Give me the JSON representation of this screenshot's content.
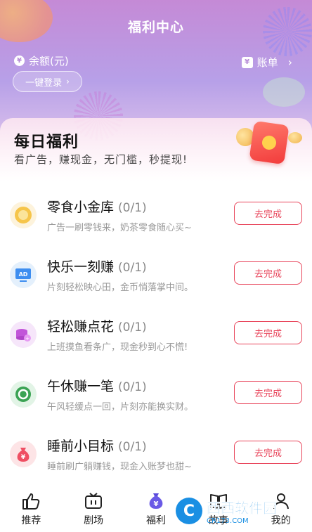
{
  "header": {
    "title": "福利中心",
    "balance_label": "余额(元)",
    "login_label": "一键登录",
    "bill_label": "账单",
    "yen_symbol": "¥"
  },
  "daily": {
    "title": "每日福利",
    "subtitle": "看广告，赚现金，无门槛，秒提现!"
  },
  "tasks": [
    {
      "name": "零食小金库",
      "progress": "(0/1)",
      "desc": "广告一刷零钱来，奶茶零食随心买~",
      "button": "去完成",
      "icon": "coin-icon"
    },
    {
      "name": "快乐一刻赚",
      "progress": "(0/1)",
      "desc": "片刻轻松映心田，金币悄落掌中间。",
      "button": "去完成",
      "icon": "ad-screen-icon"
    },
    {
      "name": "轻松赚点花",
      "progress": "(0/1)",
      "desc": "上班摸鱼看条广，现金秒到心不慌!",
      "button": "去完成",
      "icon": "coin-stack-icon"
    },
    {
      "name": "午休赚一笔",
      "progress": "(0/1)",
      "desc": "午风轻缓点一回，片刻亦能换实财。",
      "button": "去完成",
      "icon": "refresh-coin-icon"
    },
    {
      "name": "睡前小目标",
      "progress": "(0/1)",
      "desc": "睡前刷广躺赚钱，现金入账梦也甜~",
      "button": "去完成",
      "icon": "money-bag-icon"
    }
  ],
  "tabbar": [
    {
      "label": "推荐",
      "icon": "thumbs-up-icon"
    },
    {
      "label": "剧场",
      "icon": "tv-icon"
    },
    {
      "label": "福利",
      "icon": "money-bag-icon"
    },
    {
      "label": "故事",
      "icon": "book-icon"
    },
    {
      "label": "我的",
      "icon": "person-icon"
    }
  ],
  "watermark": {
    "main": "西西软件园",
    "sub": "CR173.COM",
    "logo": "C"
  },
  "colors": {
    "accent": "#e8445a",
    "hero_purple": "#b7a0e8"
  }
}
